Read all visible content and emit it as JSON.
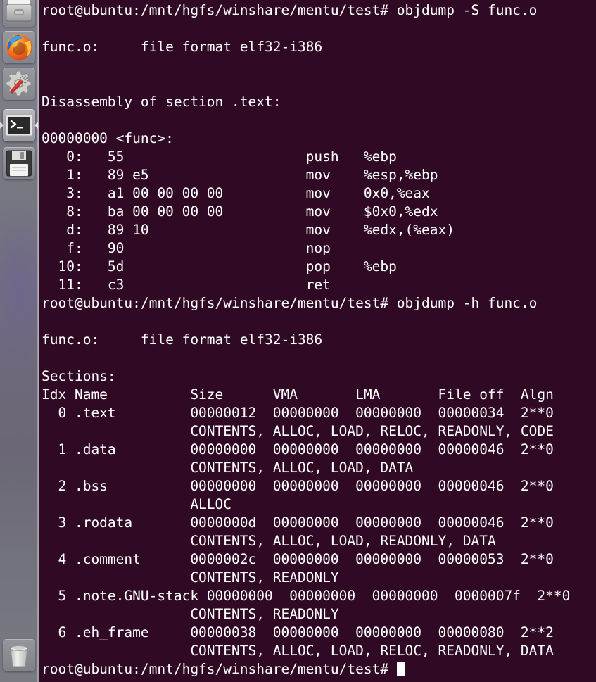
{
  "launcher": {
    "items": [
      {
        "name": "files-icon",
        "label": "Files",
        "active": false,
        "running": false
      },
      {
        "name": "firefox-icon",
        "label": "Firefox Web Browser",
        "active": false,
        "running": false
      },
      {
        "name": "system-settings-icon",
        "label": "System Settings",
        "active": false,
        "running": false
      },
      {
        "name": "terminal-icon",
        "label": "Terminal",
        "active": true,
        "running": true
      },
      {
        "name": "save-icon",
        "label": "Save",
        "active": false,
        "running": false
      }
    ],
    "trash": {
      "name": "trash-icon",
      "label": "Trash"
    }
  },
  "terminal": {
    "colors": {
      "background": "#300a24",
      "foreground": "#ffffff",
      "launcher_edge": "#b9b9c4"
    },
    "prompt": "root@ubuntu:/mnt/hgfs/winshare/mentu/test#",
    "commands": [
      "objdump -S func.o",
      "objdump -h func.o"
    ],
    "lines": [
      "root@ubuntu:/mnt/hgfs/winshare/mentu/test# objdump -S func.o",
      "",
      "func.o:     file format elf32-i386",
      "",
      "",
      "Disassembly of section .text:",
      "",
      "00000000 <func>:",
      "   0:\t55                      push   %ebp",
      "   1:\t89 e5                   mov    %esp,%ebp",
      "   3:\ta1 00 00 00 00          mov    0x0,%eax",
      "   8:\tba 00 00 00 00          mov    $0x0,%edx",
      "   d:\t89 10                   mov    %edx,(%eax)",
      "   f:\t90                      nop",
      "  10:\t5d                      pop    %ebp",
      "  11:\tc3                      ret",
      "root@ubuntu:/mnt/hgfs/winshare/mentu/test# objdump -h func.o",
      "",
      "func.o:     file format elf32-i386",
      "",
      "Sections:",
      "Idx Name          Size      VMA       LMA       File off  Algn",
      "  0 .text         00000012  00000000  00000000  00000034  2**0",
      "                  CONTENTS, ALLOC, LOAD, RELOC, READONLY, CODE",
      "  1 .data         00000000  00000000  00000000  00000046  2**0",
      "                  CONTENTS, ALLOC, LOAD, DATA",
      "  2 .bss          00000000  00000000  00000000  00000046  2**0",
      "                  ALLOC",
      "  3 .rodata       0000000d  00000000  00000000  00000046  2**0",
      "                  CONTENTS, ALLOC, LOAD, READONLY, DATA",
      "  4 .comment      0000002c  00000000  00000000  00000053  2**0",
      "                  CONTENTS, READONLY",
      "  5 .note.GNU-stack 00000000  00000000  00000000  0000007f  2**0",
      "                  CONTENTS, READONLY",
      "  6 .eh_frame     00000038  00000000  00000000  00000080  2**2",
      "                  CONTENTS, ALLOC, LOAD, RELOC, READONLY, DATA"
    ],
    "final_prompt": "root@ubuntu:/mnt/hgfs/winshare/mentu/test# ",
    "file_format": {
      "file": "func.o:",
      "text": "file format elf32-i386"
    },
    "disassembly": {
      "header": "Disassembly of section .text:",
      "symbol": "00000000 <func>:",
      "instructions": [
        {
          "addr": "0:",
          "bytes": "55",
          "mnemonic": "push",
          "operands": "%ebp"
        },
        {
          "addr": "1:",
          "bytes": "89 e5",
          "mnemonic": "mov",
          "operands": "%esp,%ebp"
        },
        {
          "addr": "3:",
          "bytes": "a1 00 00 00 00",
          "mnemonic": "mov",
          "operands": "0x0,%eax"
        },
        {
          "addr": "8:",
          "bytes": "ba 00 00 00 00",
          "mnemonic": "mov",
          "operands": "$0x0,%edx"
        },
        {
          "addr": "d:",
          "bytes": "89 10",
          "mnemonic": "mov",
          "operands": "%edx,(%eax)"
        },
        {
          "addr": "f:",
          "bytes": "90",
          "mnemonic": "nop",
          "operands": ""
        },
        {
          "addr": "10:",
          "bytes": "5d",
          "mnemonic": "pop",
          "operands": "%ebp"
        },
        {
          "addr": "11:",
          "bytes": "c3",
          "mnemonic": "ret",
          "operands": ""
        }
      ]
    },
    "sections": {
      "title": "Sections:",
      "columns": [
        "Idx",
        "Name",
        "Size",
        "VMA",
        "LMA",
        "File off",
        "Algn"
      ],
      "rows": [
        {
          "idx": "0",
          "name": ".text",
          "size": "00000012",
          "vma": "00000000",
          "lma": "00000000",
          "file_off": "00000034",
          "algn": "2**0",
          "flags": "CONTENTS, ALLOC, LOAD, RELOC, READONLY, CODE"
        },
        {
          "idx": "1",
          "name": ".data",
          "size": "00000000",
          "vma": "00000000",
          "lma": "00000000",
          "file_off": "00000046",
          "algn": "2**0",
          "flags": "CONTENTS, ALLOC, LOAD, DATA"
        },
        {
          "idx": "2",
          "name": ".bss",
          "size": "00000000",
          "vma": "00000000",
          "lma": "00000000",
          "file_off": "00000046",
          "algn": "2**0",
          "flags": "ALLOC"
        },
        {
          "idx": "3",
          "name": ".rodata",
          "size": "0000000d",
          "vma": "00000000",
          "lma": "00000000",
          "file_off": "00000046",
          "algn": "2**0",
          "flags": "CONTENTS, ALLOC, LOAD, READONLY, DATA"
        },
        {
          "idx": "4",
          "name": ".comment",
          "size": "0000002c",
          "vma": "00000000",
          "lma": "00000000",
          "file_off": "00000053",
          "algn": "2**0",
          "flags": "CONTENTS, READONLY"
        },
        {
          "idx": "5",
          "name": ".note.GNU-stack",
          "size": "00000000",
          "vma": "00000000",
          "lma": "00000000",
          "file_off": "0000007f",
          "algn": "2**0",
          "flags": "CONTENTS, READONLY"
        },
        {
          "idx": "6",
          "name": ".eh_frame",
          "size": "00000038",
          "vma": "00000000",
          "lma": "00000000",
          "file_off": "00000080",
          "algn": "2**2",
          "flags": "CONTENTS, ALLOC, LOAD, RELOC, READONLY, DATA"
        }
      ]
    }
  }
}
